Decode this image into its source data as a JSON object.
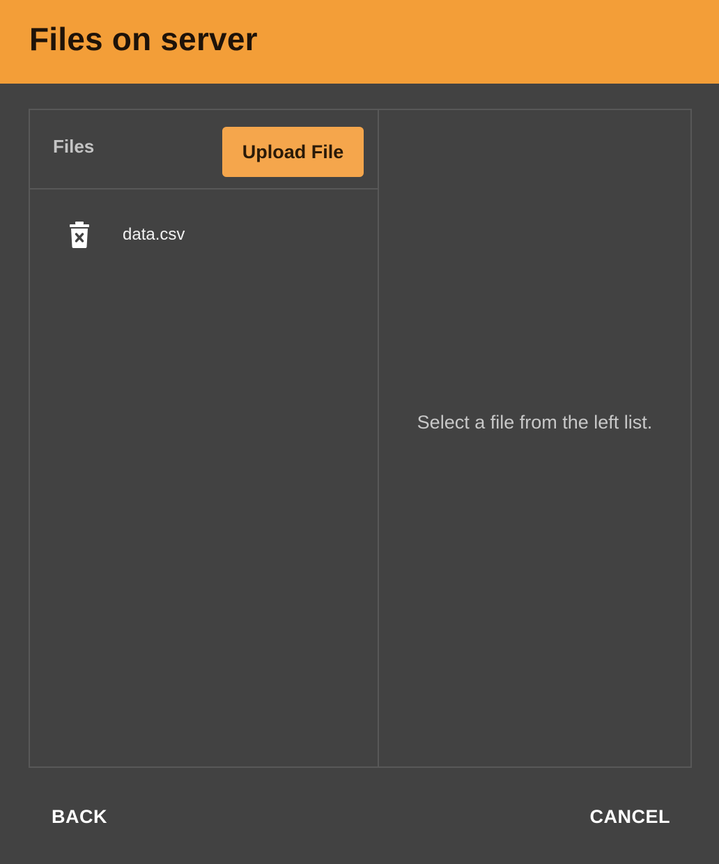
{
  "dialog": {
    "title": "Files on server"
  },
  "files_pane": {
    "label": "Files",
    "upload_label": "Upload File",
    "items": [
      {
        "name": "data.csv",
        "icon": "delete-icon"
      }
    ]
  },
  "preview_pane": {
    "empty_message": "Select a file from the left list."
  },
  "footer": {
    "back_label": "BACK",
    "cancel_label": "CANCEL"
  },
  "colors": {
    "header": "#f39e38",
    "accent_button": "#f5a64c",
    "background": "#424242",
    "border": "#585858"
  }
}
